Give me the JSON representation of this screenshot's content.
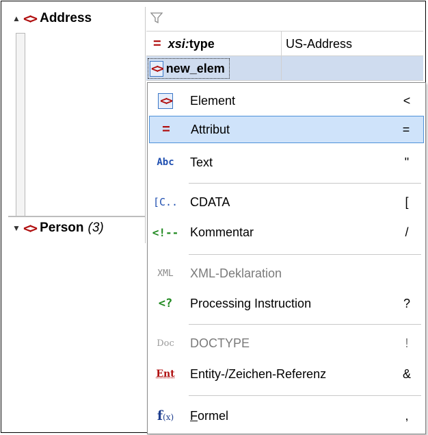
{
  "tree": {
    "nodes": [
      {
        "label": "Address",
        "count": "",
        "expander": "▲"
      },
      {
        "label": "Person",
        "count": "(3)",
        "expander": "▼"
      }
    ]
  },
  "grid": {
    "filter_icon": "filter-icon",
    "rows": [
      {
        "name": "xsi:type",
        "name_prefix": "xsi:",
        "name_local": "type",
        "value": "US-Address"
      },
      {
        "name": "new_elem",
        "value": ""
      }
    ]
  },
  "menu": {
    "items": [
      {
        "icon": "element-icon",
        "icon_text": "<>",
        "label": "Element",
        "shortcut": "<",
        "state": "normal"
      },
      {
        "icon": "attribute-icon",
        "icon_text": "=",
        "label": "Attribut",
        "shortcut": "=",
        "state": "highlighted"
      },
      {
        "icon": "text-icon",
        "icon_text": "Abc",
        "label": "Text",
        "shortcut": "\"",
        "state": "normal"
      },
      {
        "icon": "cdata-icon",
        "icon_text": "[C..",
        "label": "CDATA",
        "shortcut": "[",
        "state": "normal"
      },
      {
        "icon": "comment-icon",
        "icon_text": "<!--",
        "label": "Kommentar",
        "shortcut": "/",
        "state": "normal"
      },
      {
        "icon": "xml-declaration-icon",
        "icon_text": "XML",
        "label": "XML-Deklaration",
        "shortcut": "",
        "state": "disabled"
      },
      {
        "icon": "processing-instruction-icon",
        "icon_text": "<?",
        "label": "Processing Instruction",
        "shortcut": "?",
        "state": "normal"
      },
      {
        "icon": "doctype-icon",
        "icon_text": "Doc",
        "label": "DOCTYPE",
        "shortcut": "!",
        "state": "disabled"
      },
      {
        "icon": "entity-reference-icon",
        "icon_text": "Ent",
        "label": "Entity-/Zeichen-Referenz",
        "shortcut": "&",
        "state": "normal"
      },
      {
        "icon": "formula-icon",
        "icon_text": "f(x)",
        "label_first": "F",
        "label_rest": "ormel",
        "label": "Formel",
        "shortcut": ",",
        "state": "normal"
      }
    ]
  },
  "colors": {
    "accent_red": "#b01010",
    "highlight_bg": "#cfe3fa",
    "highlight_border": "#4d90d8",
    "selection_bg": "#cfdcef"
  }
}
